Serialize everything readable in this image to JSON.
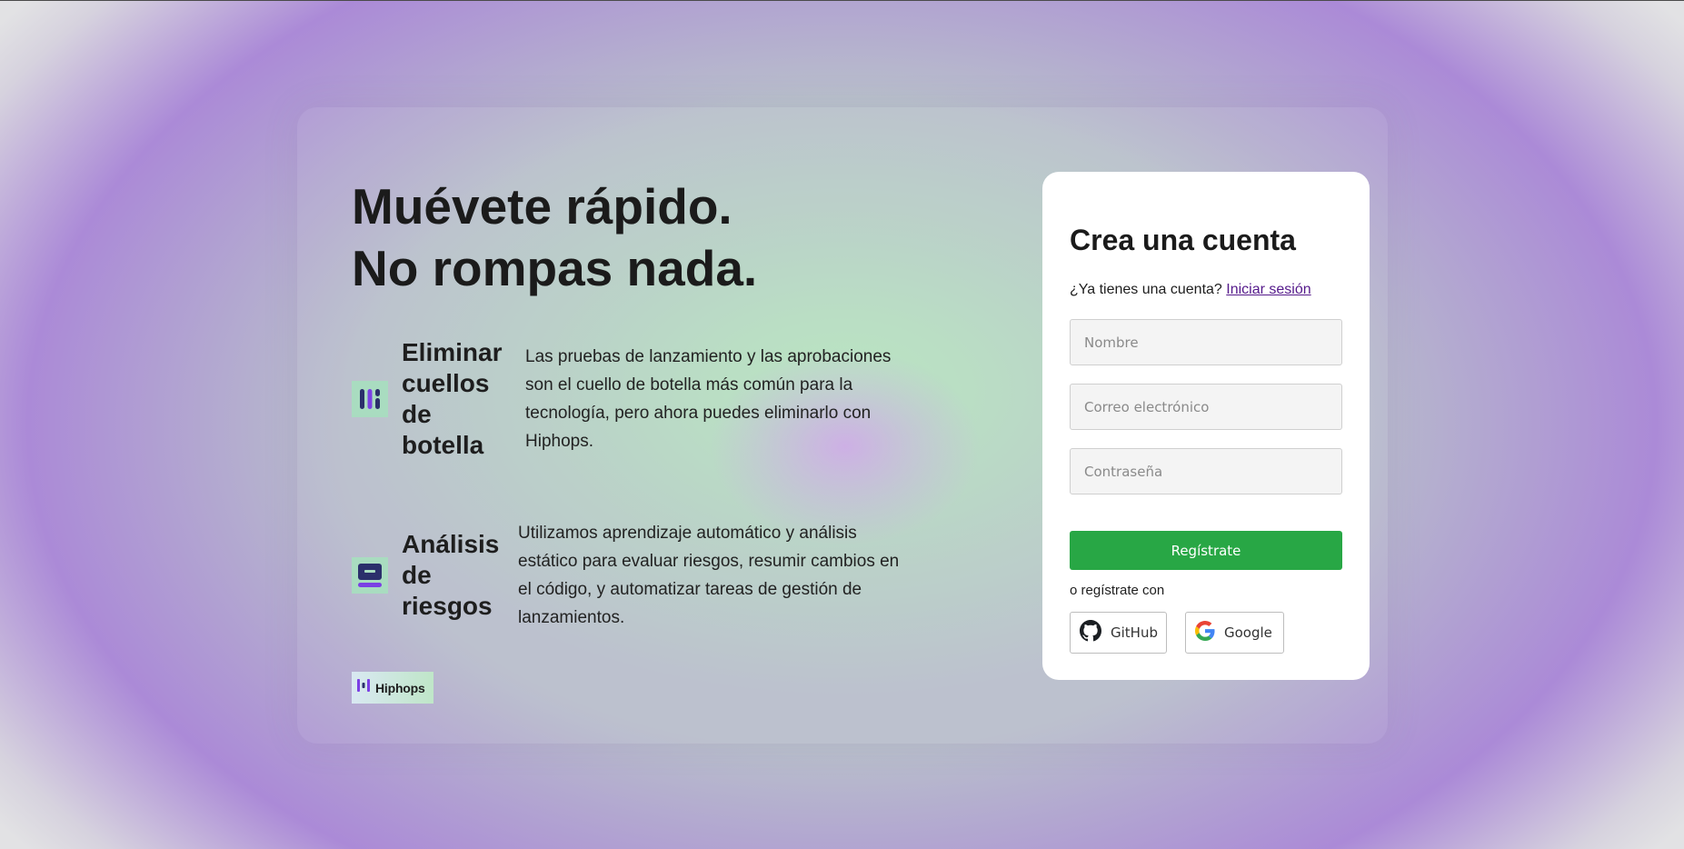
{
  "hero": {
    "headline_line1": "Muévete rápido.",
    "headline_line2": "No rompas nada."
  },
  "features": [
    {
      "icon": "bottleneck-bars-icon",
      "title": "Eliminar cuellos de botella",
      "description": "Las pruebas de lanzamiento y las aprobaciones son el cuello de botella más común para la tecnología, pero ahora puedes eliminarlo con Hiphops."
    },
    {
      "icon": "risk-analysis-icon",
      "title": "Análisis de riesgos",
      "description": "Utilizamos aprendizaje automático y análisis estático para evaluar riesgos, resumir cambios en el código, y automatizar tareas de gestión de lanzamientos."
    }
  ],
  "brand": {
    "name": "Hiphops",
    "icon": "hiphops-logo-icon"
  },
  "signup": {
    "title": "Crea una cuenta",
    "have_account_text": "¿Ya tienes una cuenta?",
    "login_link": "Iniciar sesión",
    "name_placeholder": "Nombre",
    "email_placeholder": "Correo electrónico",
    "password_placeholder": "Contraseña",
    "submit_label": "Regístrate",
    "alt_text": "o regístrate con",
    "github_label": "GitHub",
    "google_label": "Google"
  },
  "colors": {
    "primary_button": "#28a745",
    "link": "#551a8b",
    "icon_accent": "#7b3fe4",
    "icon_dark": "#2b2f6b",
    "icon_bg": "#a9dcc0"
  }
}
